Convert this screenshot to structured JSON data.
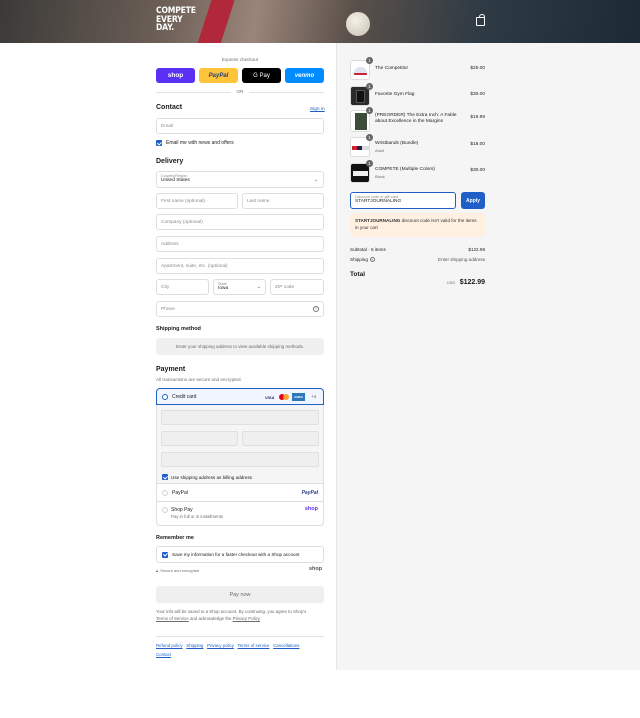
{
  "header": {
    "logo_lines": [
      "COMPETE",
      "EVERY",
      "DAY."
    ]
  },
  "express": {
    "title": "Express checkout",
    "buttons": [
      {
        "label": "shop",
        "color": "#5a31f4"
      },
      {
        "label": "PayPal",
        "color": "#ffc439"
      },
      {
        "label": "G Pay",
        "color": "#000000"
      },
      {
        "label": "venmo",
        "color": "#008cff"
      }
    ],
    "or": "OR"
  },
  "contact": {
    "title": "Contact",
    "sign_in": "Sign in",
    "email_placeholder": "Email",
    "news_label": "Email me with news and offers"
  },
  "delivery": {
    "title": "Delivery",
    "country_label": "Country/Region",
    "country_value": "United States",
    "first_name": "First name (optional)",
    "last_name": "Last name",
    "company": "Company (optional)",
    "address": "Address",
    "apartment": "Apartment, suite, etc. (optional)",
    "city": "City",
    "state_label": "State",
    "state_value": "Iowa",
    "zip": "ZIP code",
    "phone": "Phone"
  },
  "shipping_method": {
    "title": "Shipping method",
    "note": "Enter your shipping address to view available shipping methods."
  },
  "payment": {
    "title": "Payment",
    "subtitle": "All transactions are secure and encrypted.",
    "credit_card": "Credit card",
    "card_brands": [
      "VISA",
      "MC",
      "AMEX"
    ],
    "more_brands": "+4",
    "billing_label": "Use shipping address as billing address",
    "paypal": "PayPal",
    "paypal_logo": "PayPal",
    "shop_pay": "Shop Pay",
    "shop_pay_sub": "Pay in full or in installments",
    "shop_logo": "shop"
  },
  "remember": {
    "title": "Remember me",
    "save_label": "Save my information for a faster checkout with a Shop account",
    "secure": "Secure and encrypted",
    "shop_logo": "shop"
  },
  "pay_button": "Pay now",
  "disclaimer": {
    "text": "Your info will be saved to a Shop account. By continuing, you agree to Shop's",
    "terms": "Terms of Service",
    "and": "and acknowledge the",
    "privacy": "Privacy Policy"
  },
  "footer_links": [
    "Refund policy",
    "Shipping",
    "Privacy policy",
    "Terms of service",
    "Cancellations",
    "Contact"
  ],
  "order": {
    "items": [
      {
        "name": "The Competitor",
        "sub": "",
        "price": "$25.00",
        "qty": "1"
      },
      {
        "name": "Favorite Gym Flag",
        "sub": "",
        "price": "$30.00",
        "qty": "1"
      },
      {
        "name": "(PREORDER) The Extra Inch: A Fable about Excellence in the Margins",
        "sub": "",
        "price": "$19.99",
        "qty": "1"
      },
      {
        "name": "Wristbands (Bundle)",
        "sub": "Adult",
        "price": "$18.00",
        "qty": "1"
      },
      {
        "name": "COMPETE (Multiple Colors)",
        "sub": "Black",
        "price": "$30.00",
        "qty": "1"
      }
    ],
    "discount_label": "Discount code or gift card",
    "discount_value": "STARTJOURNALING",
    "apply": "Apply",
    "error_code": "STARTJOURNALING",
    "error_text": "discount code isn't valid for the items in your cart",
    "subtotal_label": "Subtotal · 5 items",
    "subtotal_value": "$122.99",
    "shipping_label": "Shipping",
    "shipping_value": "Enter shipping address",
    "total_label": "Total",
    "currency": "USD",
    "total_value": "$122.99"
  }
}
